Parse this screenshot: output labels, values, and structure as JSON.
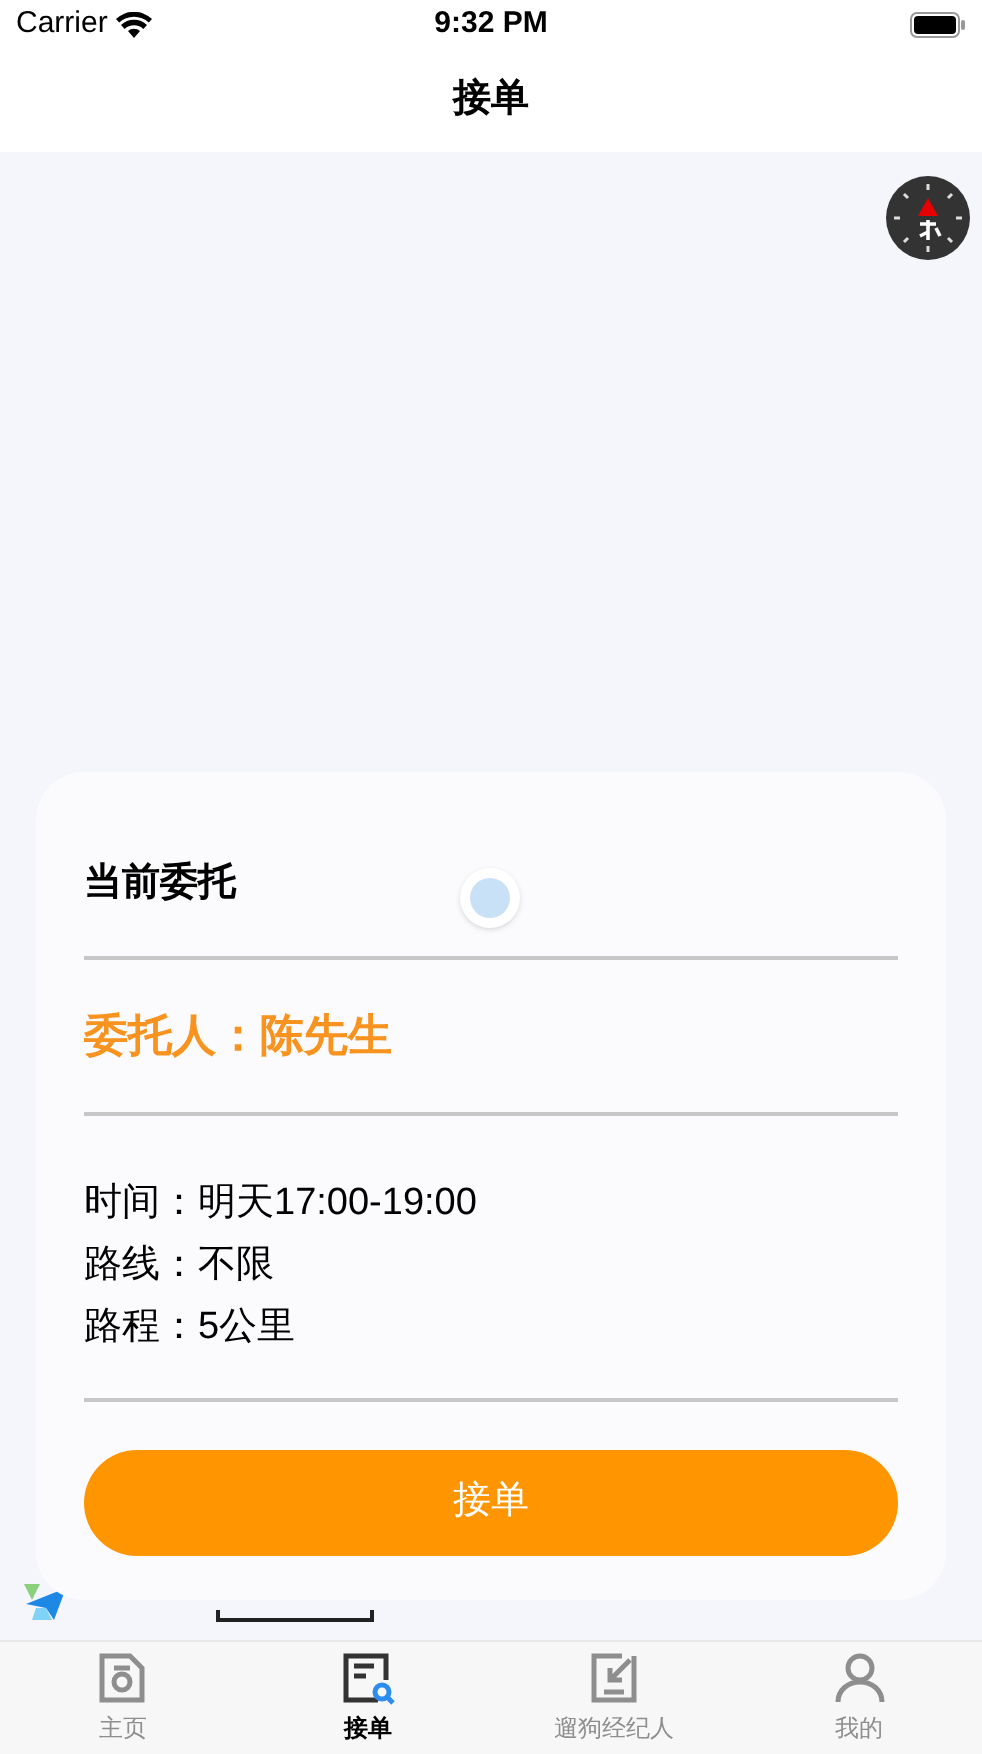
{
  "status_bar": {
    "carrier": "Carrier",
    "time": "9:32 PM"
  },
  "nav": {
    "title": "接单"
  },
  "card": {
    "title": "当前委托",
    "client": "委托人：陈先生",
    "details": [
      "时间：明天17:00-19:00",
      "路线：不限",
      "路程：5公里"
    ],
    "button": "接单"
  },
  "tabs": [
    {
      "label": "主页",
      "selected": false,
      "kind": "home"
    },
    {
      "label": "接单",
      "selected": true,
      "kind": "orders"
    },
    {
      "label": "遛狗经纪人",
      "selected": false,
      "kind": "agent"
    },
    {
      "label": "我的",
      "selected": false,
      "kind": "profile"
    }
  ]
}
